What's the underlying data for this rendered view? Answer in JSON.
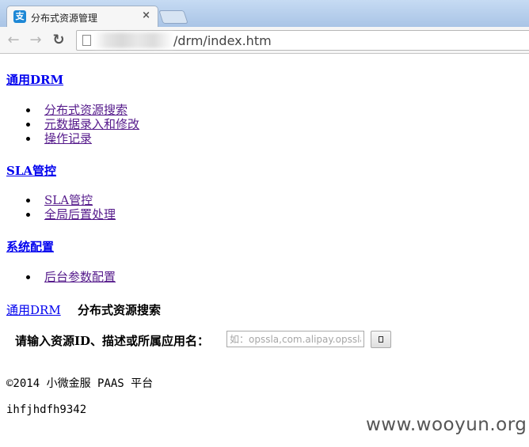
{
  "browser": {
    "tab_title": "分布式资源管理",
    "tab_close": "×",
    "back_glyph": "←",
    "forward_glyph": "→",
    "reload_glyph": "↻",
    "url_visible": "/drm/index.htm"
  },
  "nav": {
    "sections": [
      {
        "label": "通用DRM",
        "items": [
          "分布式资源搜索",
          "元数据录入和修改",
          "操作记录"
        ]
      },
      {
        "label": "SLA管控",
        "items": [
          "SLA管控",
          "全局后置处理"
        ]
      },
      {
        "label": "系统配置",
        "items": [
          "后台参数配置"
        ]
      }
    ]
  },
  "breadcrumb": {
    "link": "通用DRM",
    "current": "分布式资源搜索"
  },
  "search": {
    "label": "请输入资源ID、描述或所属应用名：",
    "placeholder": "如：opssla,com.alipay.opssla",
    "value": ""
  },
  "footer": {
    "copyright": "©2014 小微金服 PAAS 平台",
    "code": "ihfjhdfh9342"
  },
  "watermark": "www.wooyun.org"
}
